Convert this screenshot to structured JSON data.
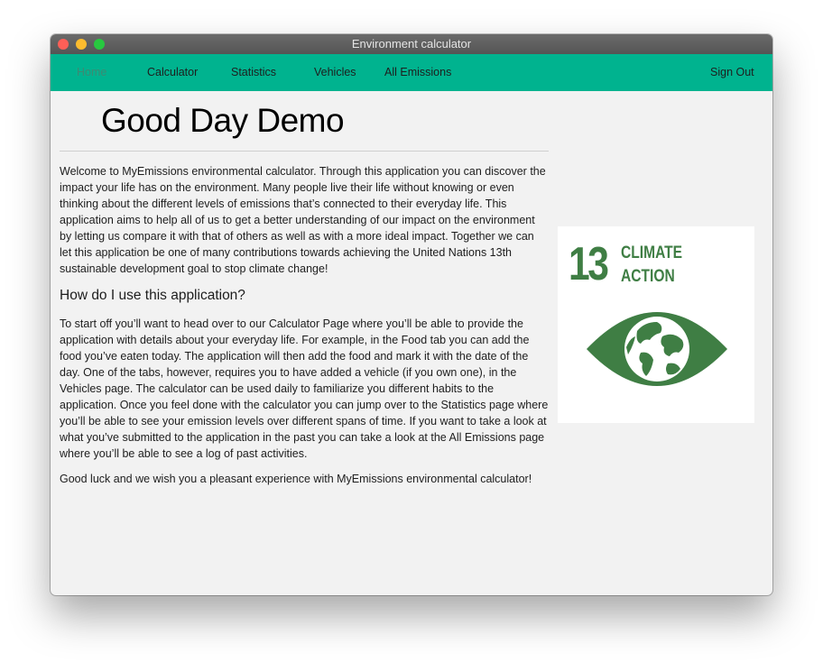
{
  "window": {
    "title": "Environment calculator"
  },
  "nav": {
    "items": [
      {
        "label": "Home",
        "active": true
      },
      {
        "label": "Calculator",
        "active": false
      },
      {
        "label": "Statistics",
        "active": false
      },
      {
        "label": "Vehicles",
        "active": false
      },
      {
        "label": "All Emissions",
        "active": false
      }
    ],
    "sign_out": "Sign Out"
  },
  "main": {
    "greeting": "Good Day Demo",
    "intro": "Welcome to MyEmissions environmental calculator. Through this application you can discover the impact your life has on the environment. Many people live their life without knowing or even thinking about the different levels of emissions that’s connected to their everyday life. This application aims to help all of us to get a better understanding of our impact on the environment by letting us compare it with that of others as well as with a more ideal impact. Together we can let this application be one of many contributions towards achieving the United Nations 13th sustainable development goal to stop climate change!",
    "how_heading": "How do I use this application?",
    "how_text": "To start off you’ll want to head over to our Calculator Page where you’ll be able to provide the application with details about your everyday life. For example, in the Food tab you can add the food you’ve eaten today. The application will then add the food and mark it with the date of the day. One of the tabs, however, requires you to have added a vehicle (if you own one), in the Vehicles page. The calculator can be used daily to familiarize you different habits to the application. Once you feel done with the calculator you can jump over to the Statistics page where you’ll be able to see your emission levels over different spans of time. If you want to take a look at what you’ve submitted to the application in the past you can take a look at the All Emissions page where you’ll be able to see a log of past activities.",
    "closing": "Good luck and we wish you a pleasant experience with MyEmissions environmental calculator!"
  },
  "sdg_badge": {
    "number": "13",
    "title_line1": "CLIMATE",
    "title_line2": "ACTION",
    "icon": "eye-globe-icon",
    "color": "#3f7e44"
  },
  "colors": {
    "navbar": "#00b38f",
    "background": "#f2f2f2"
  }
}
